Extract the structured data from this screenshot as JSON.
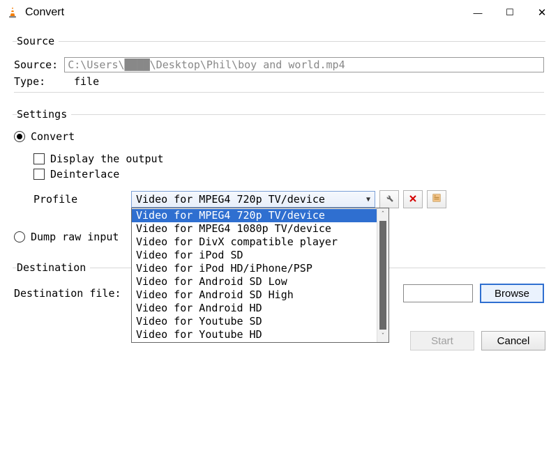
{
  "window": {
    "title": "Convert",
    "minimize": "—",
    "maximize": "☐",
    "close": "✕"
  },
  "source": {
    "legend": "Source",
    "source_label": "Source: ",
    "source_value": "C:\\Users\\████\\Desktop\\Phil\\boy and world.mp4",
    "type_label": "Type:",
    "type_value": "file"
  },
  "settings": {
    "legend": "Settings",
    "convert_label": "Convert",
    "display_output_label": "Display the output",
    "deinterlace_label": "Deinterlace",
    "profile_label": "Profile",
    "profile_selected": "Video for MPEG4 720p TV/device",
    "profile_options": [
      "Video for MPEG4 720p TV/device",
      "Video for MPEG4 1080p TV/device",
      "Video for DivX compatible player",
      "Video for iPod SD",
      "Video for iPod HD/iPhone/PSP",
      "Video for Android SD Low",
      "Video for Android SD High",
      "Video for Android HD",
      "Video for Youtube SD",
      "Video for Youtube HD"
    ],
    "dump_raw_label": "Dump raw input"
  },
  "destination": {
    "legend": "Destination",
    "file_label": "Destination file:",
    "browse_label": "Browse"
  },
  "footer": {
    "start_label": "Start",
    "cancel_label": "Cancel"
  },
  "icons": {
    "wrench": "wrench",
    "delete": "delete",
    "new": "new-profile"
  }
}
